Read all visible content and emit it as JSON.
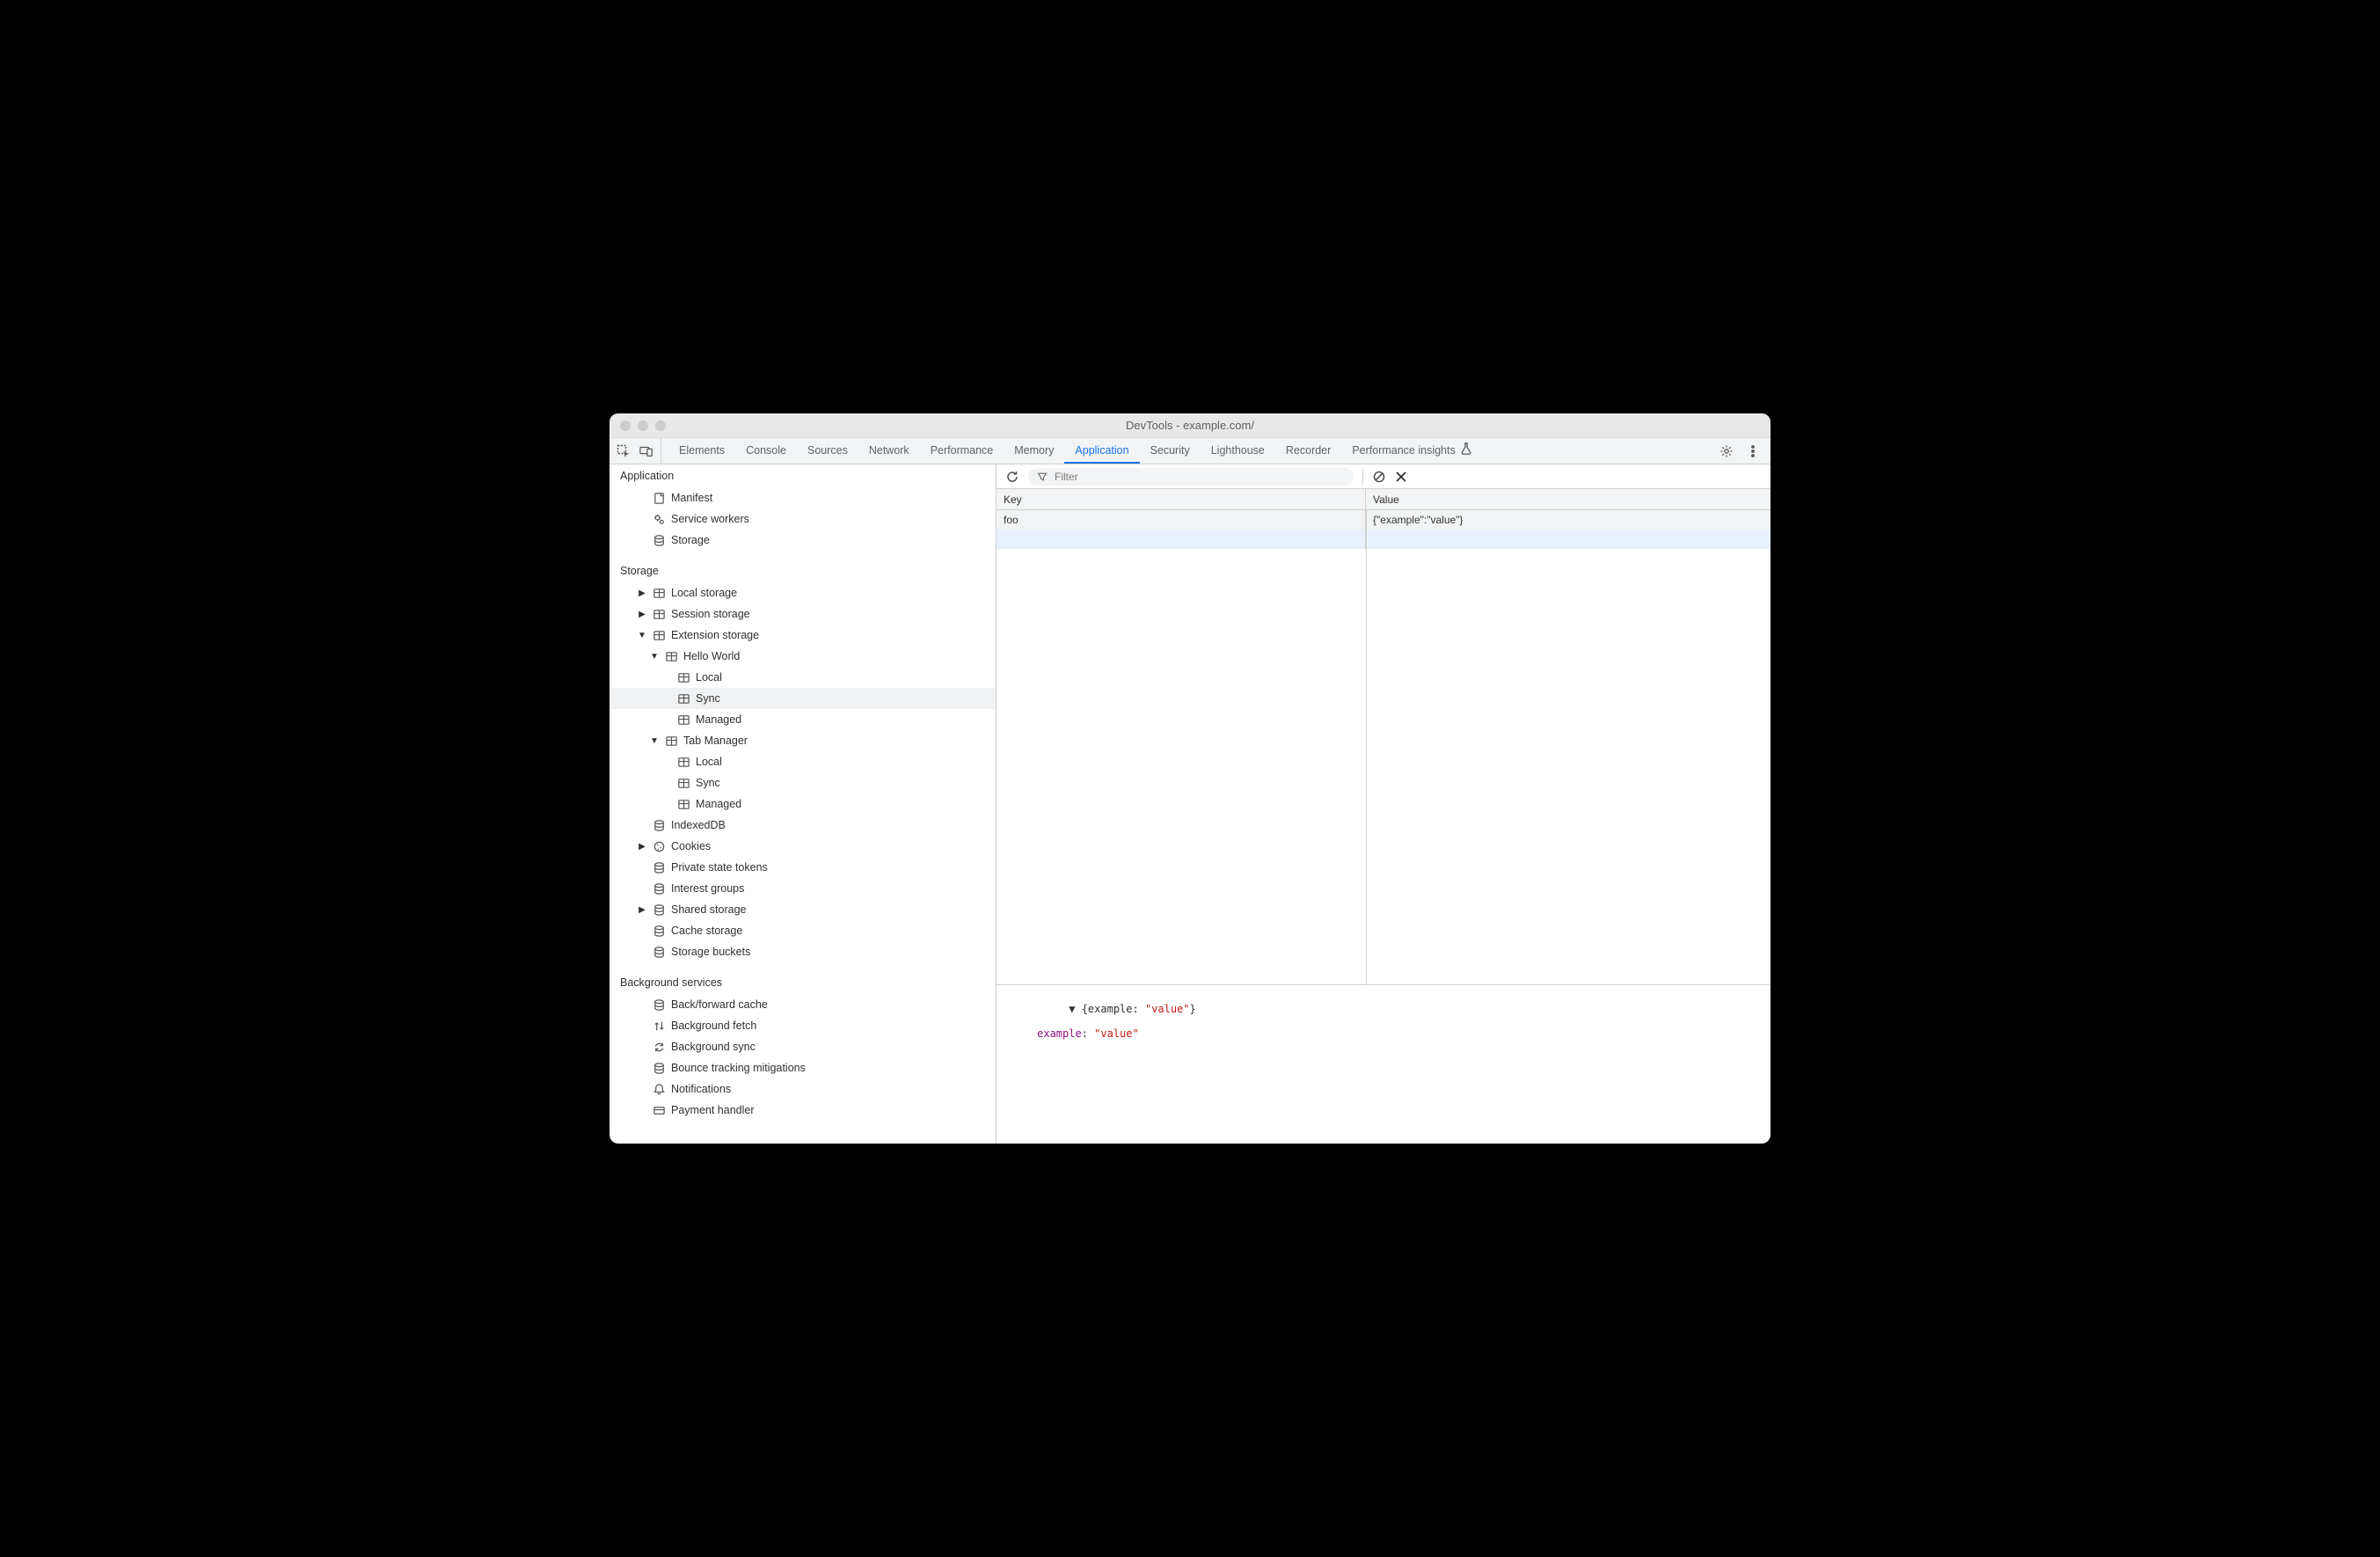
{
  "window": {
    "title": "DevTools - example.com/"
  },
  "tabs": [
    {
      "label": "Elements",
      "active": false
    },
    {
      "label": "Console",
      "active": false
    },
    {
      "label": "Sources",
      "active": false
    },
    {
      "label": "Network",
      "active": false
    },
    {
      "label": "Performance",
      "active": false
    },
    {
      "label": "Memory",
      "active": false
    },
    {
      "label": "Application",
      "active": true
    },
    {
      "label": "Security",
      "active": false
    },
    {
      "label": "Lighthouse",
      "active": false
    },
    {
      "label": "Recorder",
      "active": false
    },
    {
      "label": "Performance insights",
      "active": false,
      "flask": true
    }
  ],
  "sidebar": {
    "sections": [
      {
        "title": "Application",
        "items": [
          {
            "label": "Manifest",
            "icon": "document"
          },
          {
            "label": "Service workers",
            "icon": "gears"
          },
          {
            "label": "Storage",
            "icon": "database"
          }
        ]
      },
      {
        "title": "Storage",
        "items": [
          {
            "label": "Local storage",
            "icon": "table",
            "arrow": "right"
          },
          {
            "label": "Session storage",
            "icon": "table",
            "arrow": "right"
          },
          {
            "label": "Extension storage",
            "icon": "table",
            "arrow": "down",
            "children": [
              {
                "label": "Hello World",
                "icon": "table",
                "arrow": "down",
                "children": [
                  {
                    "label": "Local",
                    "icon": "table"
                  },
                  {
                    "label": "Sync",
                    "icon": "table",
                    "selected": true
                  },
                  {
                    "label": "Managed",
                    "icon": "table"
                  }
                ]
              },
              {
                "label": "Tab Manager",
                "icon": "table",
                "arrow": "down",
                "children": [
                  {
                    "label": "Local",
                    "icon": "table"
                  },
                  {
                    "label": "Sync",
                    "icon": "table"
                  },
                  {
                    "label": "Managed",
                    "icon": "table"
                  }
                ]
              }
            ]
          },
          {
            "label": "IndexedDB",
            "icon": "database"
          },
          {
            "label": "Cookies",
            "icon": "cookie",
            "arrow": "right"
          },
          {
            "label": "Private state tokens",
            "icon": "database"
          },
          {
            "label": "Interest groups",
            "icon": "database"
          },
          {
            "label": "Shared storage",
            "icon": "database",
            "arrow": "right"
          },
          {
            "label": "Cache storage",
            "icon": "database"
          },
          {
            "label": "Storage buckets",
            "icon": "database"
          }
        ]
      },
      {
        "title": "Background services",
        "items": [
          {
            "label": "Back/forward cache",
            "icon": "database"
          },
          {
            "label": "Background fetch",
            "icon": "updown"
          },
          {
            "label": "Background sync",
            "icon": "sync"
          },
          {
            "label": "Bounce tracking mitigations",
            "icon": "database"
          },
          {
            "label": "Notifications",
            "icon": "bell"
          },
          {
            "label": "Payment handler",
            "icon": "card"
          }
        ]
      }
    ]
  },
  "filter": {
    "placeholder": "Filter"
  },
  "table": {
    "columns": [
      "Key",
      "Value"
    ],
    "rows": [
      {
        "key": "foo",
        "value": "{\"example\":\"value\"}"
      }
    ]
  },
  "preview": {
    "summary_open": "{example: ",
    "summary_str": "\"value\"",
    "summary_close": "}",
    "prop_key": "example",
    "prop_val": "\"value\""
  }
}
